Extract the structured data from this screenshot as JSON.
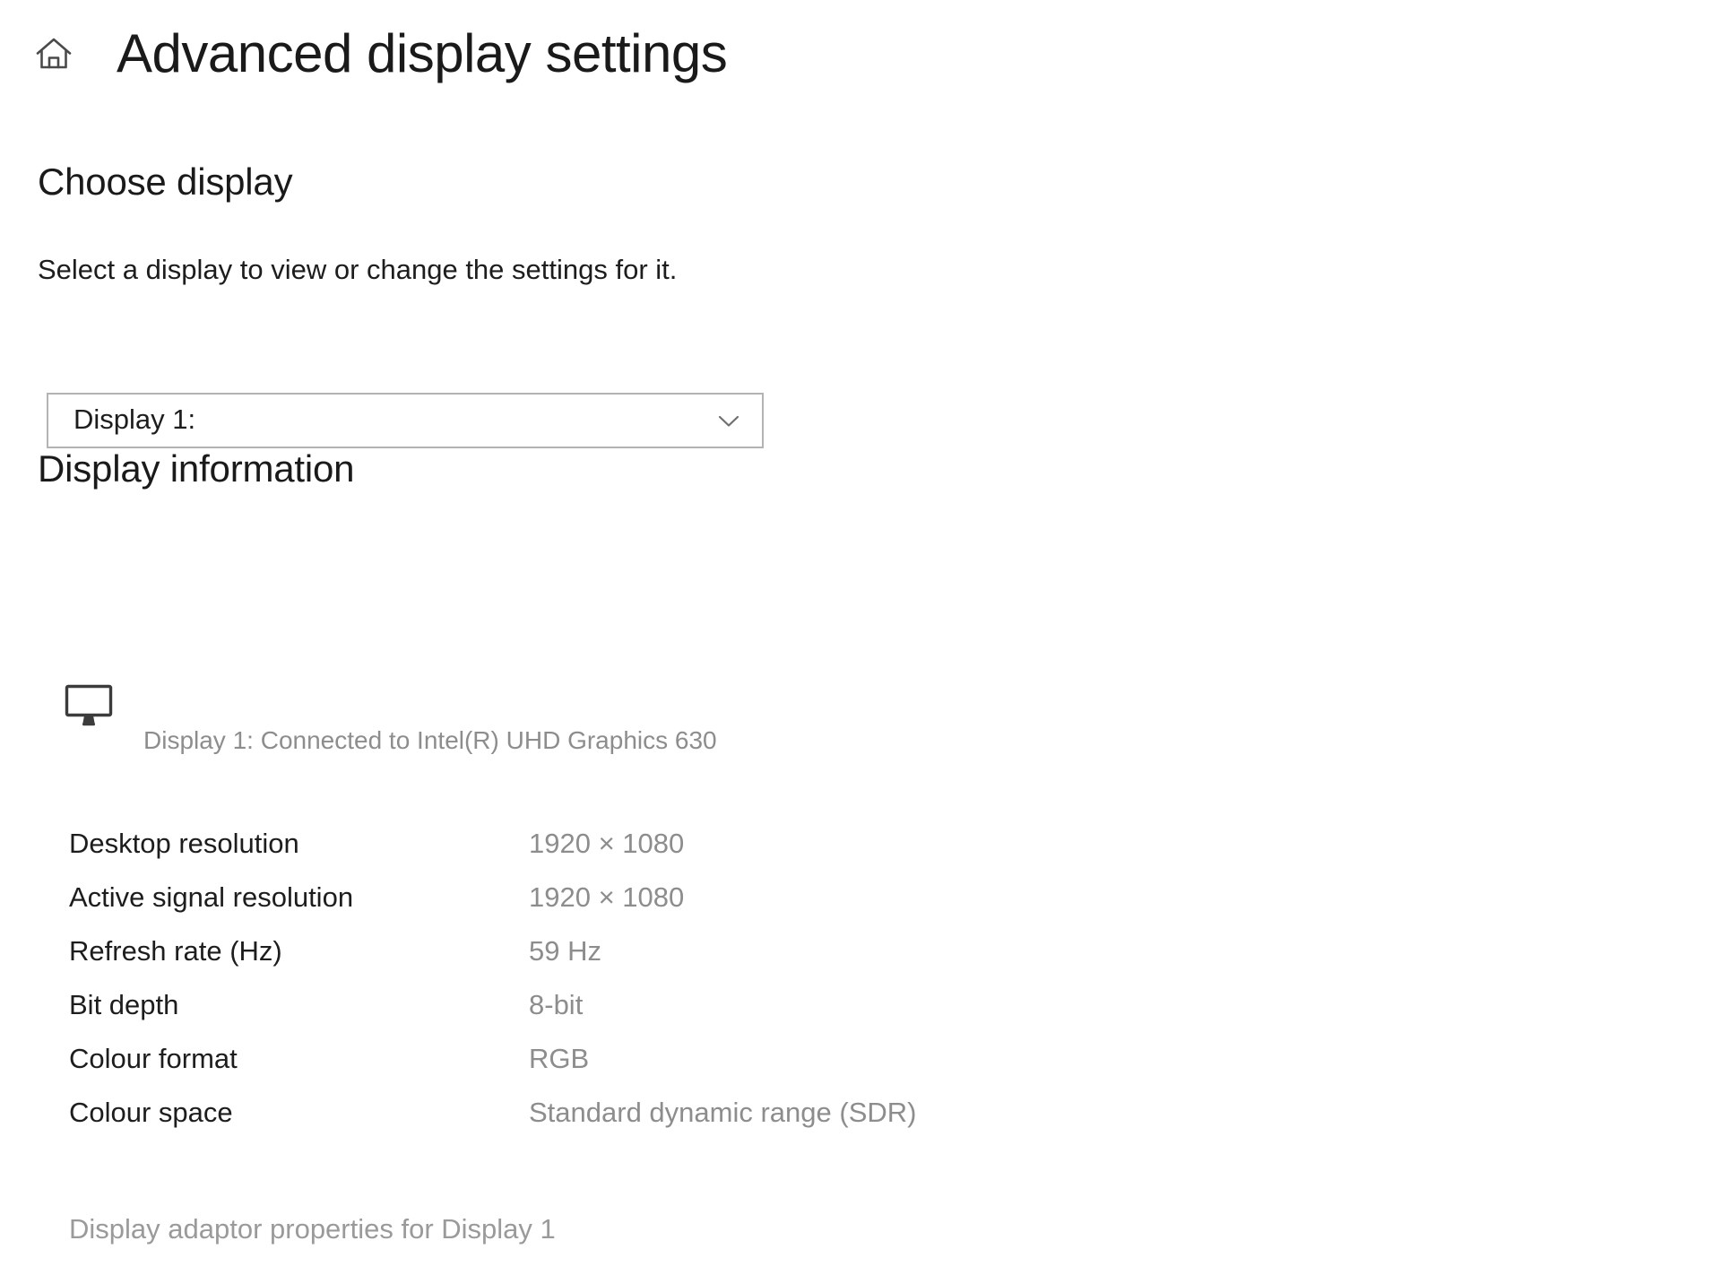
{
  "header": {
    "home_icon": "home-icon",
    "title": "Advanced display settings"
  },
  "choose_display": {
    "heading": "Choose display",
    "subtext": "Select a display to view or change the settings for it.",
    "dropdown": {
      "selected": "Display 1:",
      "chevron_icon": "chevron-down-icon"
    }
  },
  "display_information": {
    "heading": "Display information",
    "monitor_icon": "monitor-icon",
    "connection_caption": "Display 1: Connected to Intel(R) UHD Graphics 630",
    "specs": [
      {
        "label": "Desktop resolution",
        "value": "1920 × 1080"
      },
      {
        "label": "Active signal resolution",
        "value": "1920 × 1080"
      },
      {
        "label": "Refresh rate (Hz)",
        "value": "59 Hz"
      },
      {
        "label": "Bit depth",
        "value": "8-bit"
      },
      {
        "label": "Colour format",
        "value": "RGB"
      },
      {
        "label": "Colour space",
        "value": "Standard dynamic range (SDR)"
      }
    ],
    "adaptor_link": "Display adaptor properties for Display 1"
  },
  "colors": {
    "background": "#ffffff",
    "primary_text": "#1d1d1d",
    "secondary_text": "#8d8d8d",
    "link_text": "#9a9a9a",
    "combo_border": "#b3b3b3"
  }
}
